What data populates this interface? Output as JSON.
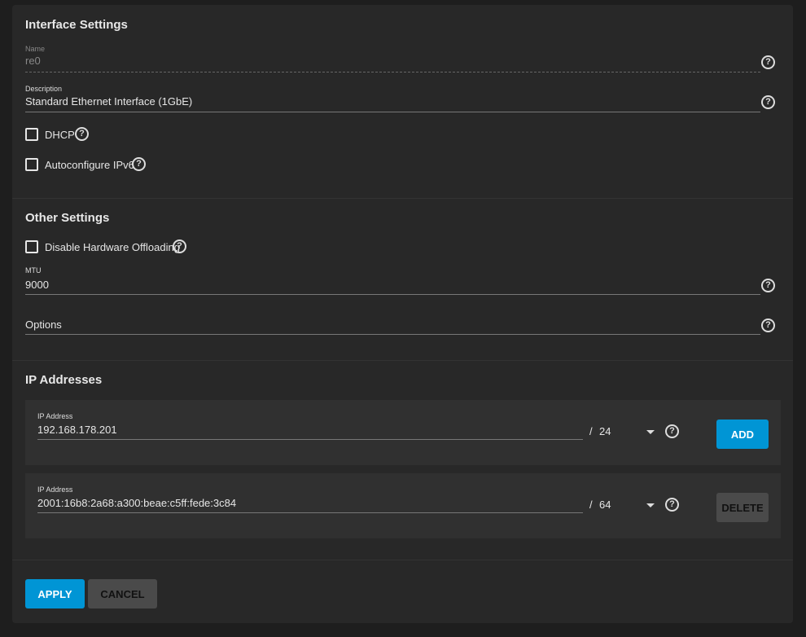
{
  "interface": {
    "title": "Interface Settings",
    "name_label": "Name",
    "name_value": "re0",
    "desc_label": "Description",
    "desc_value": "Standard Ethernet Interface (1GbE)",
    "dhcp_label": "DHCP",
    "ipv6_label": "Autoconfigure IPv6"
  },
  "other": {
    "title": "Other Settings",
    "offload_label": "Disable Hardware Offloading",
    "mtu_label": "MTU",
    "mtu_value": "9000",
    "options_label": "Options"
  },
  "ip": {
    "title": "IP Addresses",
    "rows": [
      {
        "label": "IP Address",
        "value": "192.168.178.201",
        "slash": "/",
        "mask": "24",
        "button": "ADD"
      },
      {
        "label": "IP Address",
        "value": "2001:16b8:2a68:a300:beae:c5ff:fede:3c84",
        "slash": "/",
        "mask": "64",
        "button": "DELETE"
      }
    ]
  },
  "actions": {
    "apply": "APPLY",
    "cancel": "CANCEL"
  },
  "help_glyph": "?",
  "colors": {
    "primary": "#0095d5",
    "secondary": "#4a4a4a"
  }
}
